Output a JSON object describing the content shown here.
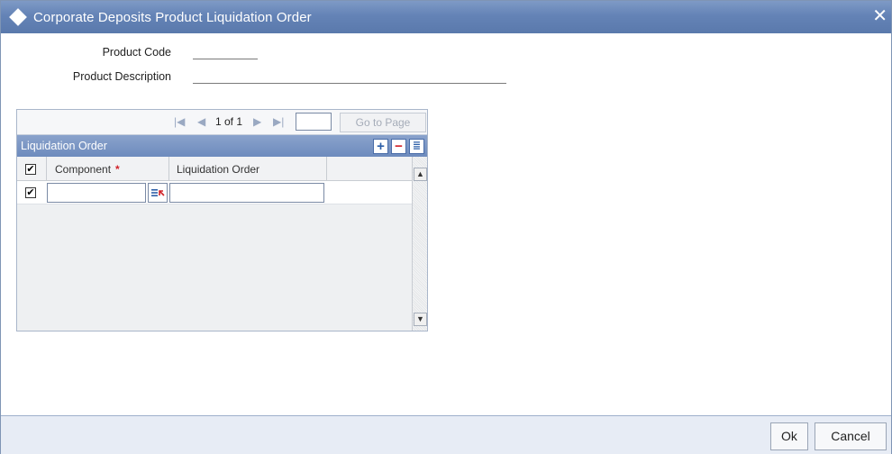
{
  "window": {
    "title": "Corporate Deposits Product Liquidation Order",
    "close_symbol": "✕"
  },
  "fields": {
    "product_code_label": "Product Code",
    "product_code_value": "",
    "product_description_label": "Product Description",
    "product_description_value": ""
  },
  "pager": {
    "first_symbol": "|◀",
    "prev_symbol": "◀",
    "page_info": "1 of 1",
    "next_symbol": "▶",
    "last_symbol": "▶|",
    "page_input_value": "",
    "goto_label": "Go to Page"
  },
  "grid": {
    "title": "Liquidation Order",
    "tools": {
      "add": "+",
      "delete": "−",
      "single_view": "≣"
    },
    "columns": [
      {
        "label": "Component",
        "required_mark": "*"
      },
      {
        "label": "Liquidation Order"
      }
    ],
    "header_checked": true,
    "rows": [
      {
        "checked": true,
        "component": "",
        "liquidation_order": ""
      }
    ],
    "scroll": {
      "up": "▲",
      "down": "▼"
    }
  },
  "footer": {
    "ok_label": "Ok",
    "cancel_label": "Cancel"
  },
  "colors": {
    "titlebar": "#6483b6",
    "grid_header": "#6d8bbd",
    "required": "#d1232a"
  }
}
